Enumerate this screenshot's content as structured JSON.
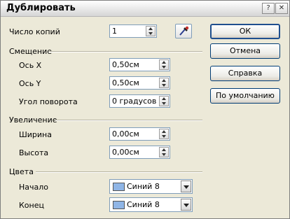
{
  "window": {
    "title": "Дублировать",
    "help_glyph": "?",
    "close_glyph": "✕"
  },
  "copies": {
    "label": "Число копий",
    "value": "1"
  },
  "placement": {
    "heading": "Смещение",
    "x_label": "Ось X",
    "x_value": "0,50см",
    "y_label": "Ось Y",
    "y_value": "0,50см",
    "angle_label": "Угол поворота",
    "angle_value": "0 градусов"
  },
  "enlargement": {
    "heading": "Увеличение",
    "width_label": "Ширина",
    "width_value": "0,00см",
    "height_label": "Высота",
    "height_value": "0,00см"
  },
  "colors": {
    "heading": "Цвета",
    "start_label": "Начало",
    "start_value": "Синий 8",
    "end_label": "Конец",
    "end_value": "Синий 8",
    "swatch_color": "#8fb5e6"
  },
  "buttons": {
    "ok": "ОК",
    "cancel": "Отмена",
    "help": "Справка",
    "default": "По умолчанию"
  }
}
